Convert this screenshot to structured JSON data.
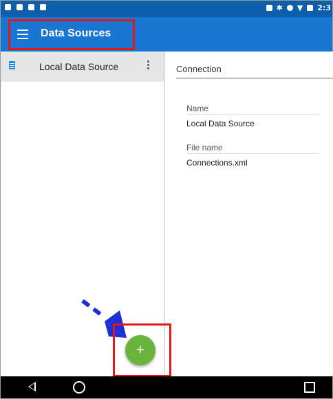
{
  "status_bar": {
    "time": "2:3"
  },
  "app_bar": {
    "title": "Data Sources"
  },
  "list": {
    "items": [
      {
        "label": "Local Data Source"
      }
    ]
  },
  "details": {
    "section": "Connection",
    "fields": [
      {
        "label": "Name",
        "value": "Local Data Source"
      },
      {
        "label": "File name",
        "value": "Connections.xml"
      }
    ]
  },
  "fab": {
    "symbol": "+"
  },
  "colors": {
    "status_bar": "#0d5fab",
    "app_bar": "#1976d2",
    "fab": "#6ab43e",
    "highlight_box": "#e01818",
    "arrow": "#1f2fd8"
  },
  "icons": [
    "menu-icon",
    "data-source-icon",
    "more-vert-icon",
    "add-icon",
    "back-icon",
    "home-icon",
    "recents-icon"
  ]
}
